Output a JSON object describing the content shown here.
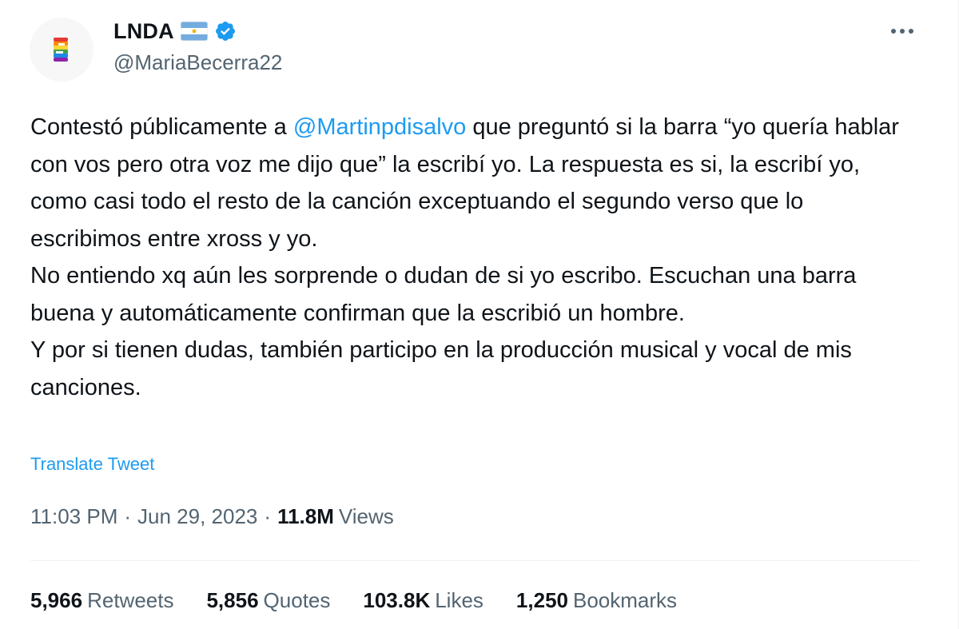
{
  "author": {
    "display_name": "LNDA",
    "handle": "@MariaBecerra22",
    "flag_icon": "argentina-flag-icon",
    "verified_icon": "verified-badge-icon",
    "verified_color": "#1d9bf0"
  },
  "more_icon": "more-horizontal-icon",
  "tweet": {
    "p1_before": "Contestó públicamente a ",
    "p1_mention": "@Martinpdisalvo",
    "p1_after": " que preguntó si la barra “yo quería hablar con vos pero otra voz me dijo que” la escribí yo. La respuesta es si, la escribí yo, como casi todo el resto de la canción exceptuando el segundo verso que lo escribimos entre xross y yo.",
    "p2": "No entiendo xq aún les sorprende o dudan de si yo escribo. Escuchan una barra buena y automáticamente confirman que la escribió un hombre.",
    "p3": "Y por si tienen dudas, también participo en la producción musical y vocal de mis canciones.",
    "translate_label": "Translate Tweet"
  },
  "meta": {
    "time": "11:03 PM",
    "separator": "·",
    "date": "Jun 29, 2023",
    "views_count": "11.8M",
    "views_label": "Views"
  },
  "stats": [
    {
      "count": "5,966",
      "label": "Retweets"
    },
    {
      "count": "5,856",
      "label": "Quotes"
    },
    {
      "count": "103.8K",
      "label": "Likes"
    },
    {
      "count": "1,250",
      "label": "Bookmarks"
    }
  ],
  "colors": {
    "accent": "#1d9bf0",
    "text_primary": "#0f1419",
    "text_secondary": "#536471",
    "divider": "#eff3f4"
  }
}
